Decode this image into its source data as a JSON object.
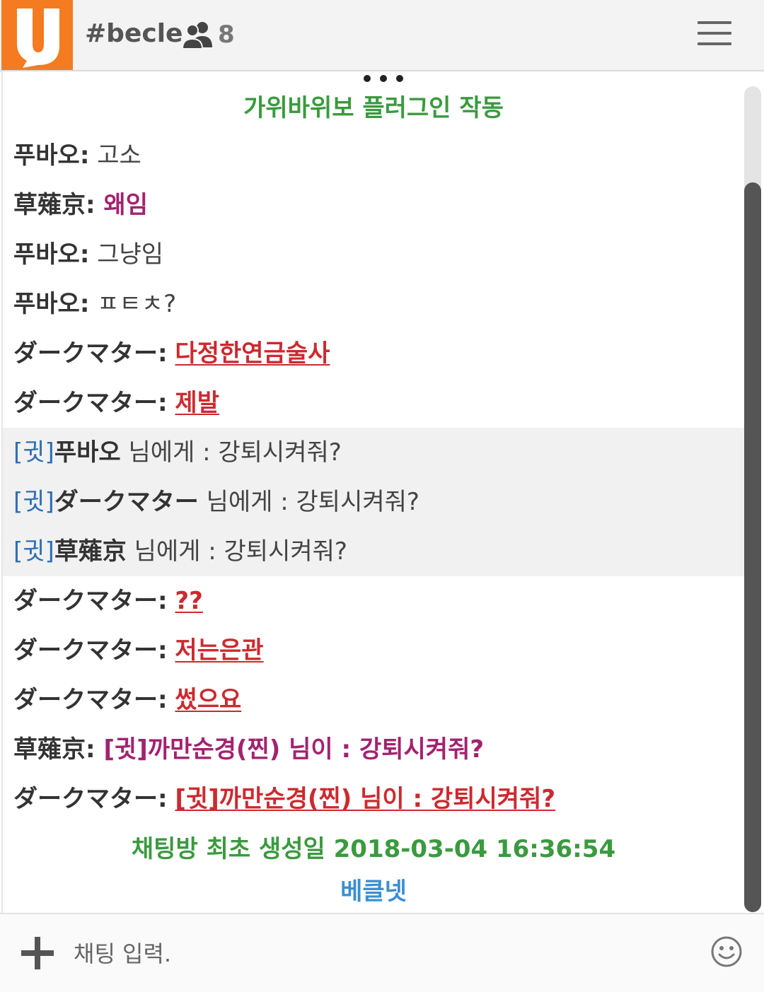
{
  "header": {
    "channel": "#becle",
    "user_count": "8"
  },
  "chat": {
    "plugin_notice": "가위바위보 플러그인 작동",
    "messages": [
      {
        "nick": "푸바오:",
        "text": " 고소"
      },
      {
        "nick": "草薙京:",
        "text": " 왜임"
      },
      {
        "nick": "푸바오:",
        "text": " 그냥임"
      },
      {
        "nick": "푸바오:",
        "text": " ㅍㅌㅊ?"
      },
      {
        "nick": "ダークマター:",
        "text": "다정한연금술사"
      },
      {
        "nick": "ダークマター:",
        "text": "제발"
      },
      {
        "tag": "[귓]",
        "nick": "푸바오",
        "text": " 님에게 : 강퇴시켜줘?"
      },
      {
        "tag": "[귓]",
        "nick": "ダークマター",
        "text": " 님에게 : 강퇴시켜줘?"
      },
      {
        "tag": "[귓]",
        "nick": "草薙京",
        "text": " 님에게 : 강퇴시켜줘?"
      },
      {
        "nick": "ダークマター:",
        "text": "??"
      },
      {
        "nick": "ダークマター:",
        "text": "저는은관"
      },
      {
        "nick": "ダークマター:",
        "text": "썼으요"
      },
      {
        "nick": "草薙京:",
        "text": " [귓]까만순경(찐) 님이 : 강퇴시켜줘?"
      },
      {
        "nick": "ダークマター:",
        "text": "[귓]까만순경(찐) 님이 : 강퇴시켜줘?"
      }
    ],
    "created_notice": "채팅방 최초 생성일 2018-03-04 16:36:54",
    "site_name": "베클넷"
  },
  "input": {
    "placeholder": "채팅 입력."
  },
  "colors": {
    "logo_bg": "#f47b20",
    "system_green": "#3a9a3e",
    "site_blue": "#3b8fd0",
    "whisper_tag_blue": "#2d6fb4",
    "purple_text": "#a3226f",
    "red_text": "#cc2a2f"
  }
}
